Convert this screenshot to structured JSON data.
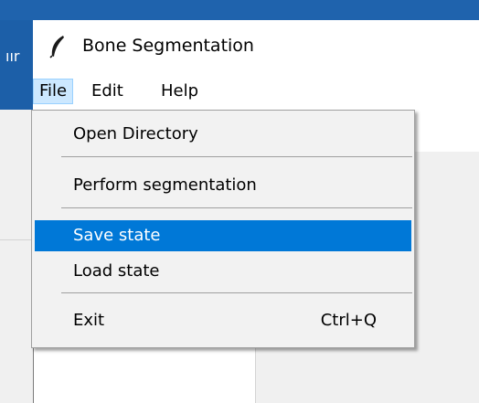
{
  "window": {
    "title": "Bone Segmentation",
    "icon": "feather-icon"
  },
  "background_app": {
    "title_fragment": "ıır"
  },
  "menubar": {
    "items": [
      {
        "label": "File",
        "active": true
      },
      {
        "label": "Edit",
        "active": false
      },
      {
        "label": "Help",
        "active": false
      }
    ]
  },
  "file_menu": {
    "items": [
      {
        "label": "Open Directory",
        "shortcut": "",
        "highlighted": false
      },
      {
        "label": "Perform segmentation",
        "shortcut": "",
        "highlighted": false
      },
      {
        "label": "Save state",
        "shortcut": "",
        "highlighted": true
      },
      {
        "label": "Load state",
        "shortcut": "",
        "highlighted": false
      },
      {
        "label": "Exit",
        "shortcut": "Ctrl+Q",
        "highlighted": false
      }
    ]
  },
  "colors": {
    "highlight": "#0078d7",
    "menubar_active": "#cce8ff",
    "background_titlebar": "#1f63ad"
  }
}
